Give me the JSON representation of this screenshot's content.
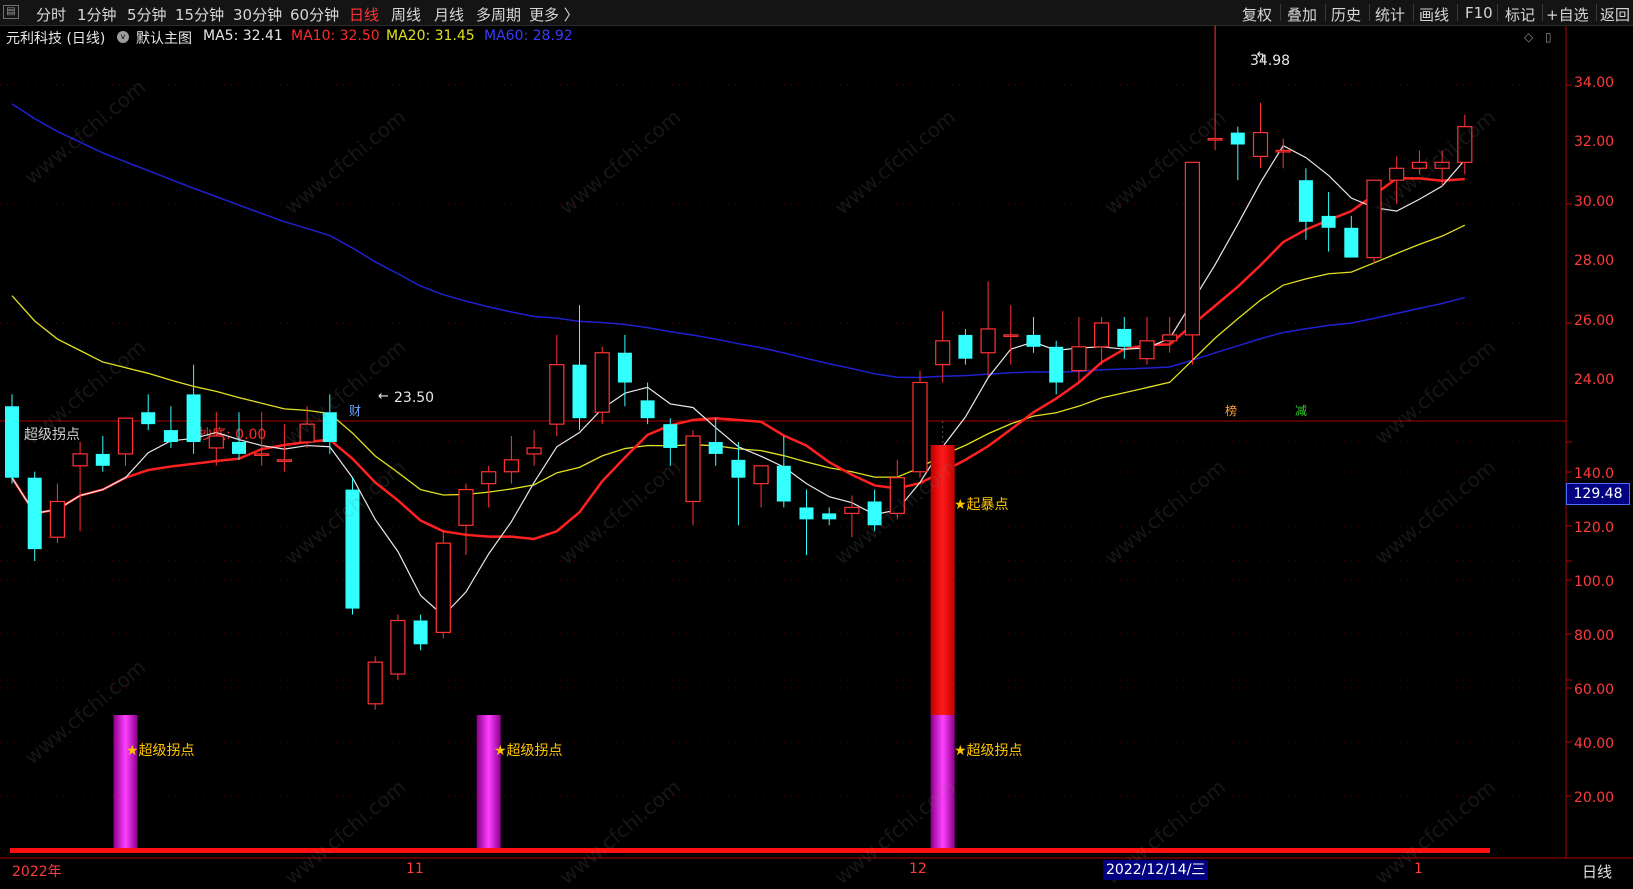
{
  "toolbar": {
    "menu_icon": "menu-icon",
    "periods": [
      "分时",
      "1分钟",
      "5分钟",
      "15分钟",
      "30分钟",
      "60分钟",
      "日线",
      "周线",
      "月线",
      "多周期",
      "更多 〉"
    ],
    "active_period": "日线",
    "tools": [
      "复权",
      "叠加",
      "历史",
      "统计",
      "画线",
      "F10",
      "标记",
      "+自选",
      "返回"
    ]
  },
  "main_chart": {
    "stock": "元利科技 (日线)",
    "template": "默认主图",
    "ma5": "MA5: 32.41",
    "ma10": "MA10: 32.50",
    "ma20": "MA20: 31.45",
    "ma60": "MA60: 28.92",
    "high_label": "34.98",
    "low_label": "23.50",
    "y_ticks": [
      "34.00",
      "32.00",
      "30.00",
      "28.00",
      "26.00",
      "24.00"
    ],
    "events": [
      {
        "text": "财",
        "color": "#6ea8ff"
      },
      {
        "text": "榜",
        "color": "#ffa030"
      },
      {
        "text": "减",
        "color": "#30d030"
      }
    ]
  },
  "indicator": {
    "name": "超级拐点",
    "value_text": "抄底: 0.00",
    "y_ticks": [
      "140.0",
      "120.0",
      "100.0",
      "80.00",
      "60.00",
      "40.00",
      "20.00"
    ],
    "cursor_value": "129.48",
    "signals": [
      {
        "label": "★超级拐点",
        "value": 50
      },
      {
        "label": "★超级拐点",
        "value": 50
      },
      {
        "label": "★超级拐点",
        "value": 50
      }
    ],
    "spike": {
      "label": "★起暴点",
      "value": 150
    }
  },
  "x_axis": {
    "labels": [
      "2022年",
      "11",
      "12",
      "1"
    ],
    "cursor_date": "2022/12/14/三",
    "period_button": "日线"
  },
  "watermark": "www.cfchi.com",
  "colors": {
    "up": "#ff3333",
    "down": "#33ffff",
    "ma5": "#e8e8e8",
    "ma10": "#ff2020",
    "ma20": "#e0e020",
    "ma60": "#2020d0"
  },
  "chart_data": {
    "type": "candlestick",
    "ma_values": {
      "MA5": 32.41,
      "MA10": 32.5,
      "MA20": 31.45,
      "MA60": 28.92
    },
    "ylim": [
      23,
      35
    ],
    "indicator_ylim": [
      0,
      150
    ],
    "candles": [
      [
        28.6,
        28.8,
        27.3,
        27.4
      ],
      [
        27.4,
        27.5,
        26.0,
        26.2
      ],
      [
        26.4,
        27.3,
        26.3,
        27.0
      ],
      [
        27.6,
        28.0,
        26.5,
        27.8
      ],
      [
        27.8,
        28.1,
        27.5,
        27.6
      ],
      [
        27.8,
        28.4,
        27.6,
        28.4
      ],
      [
        28.5,
        28.8,
        28.2,
        28.3
      ],
      [
        28.2,
        28.6,
        27.9,
        28.0
      ],
      [
        28.8,
        29.3,
        27.8,
        28.0
      ],
      [
        27.9,
        28.5,
        27.6,
        28.1
      ],
      [
        28.0,
        28.5,
        27.7,
        27.8
      ],
      [
        27.8,
        28.5,
        27.6,
        27.8
      ],
      [
        27.7,
        28.3,
        27.5,
        27.7
      ],
      [
        28.0,
        28.6,
        27.9,
        28.3
      ],
      [
        28.5,
        28.8,
        27.8,
        28.0
      ],
      [
        27.2,
        27.4,
        25.1,
        25.2
      ],
      [
        23.6,
        24.4,
        23.5,
        24.3
      ],
      [
        24.1,
        25.1,
        24.0,
        25.0
      ],
      [
        25.0,
        25.1,
        24.5,
        24.6
      ],
      [
        24.8,
        26.5,
        24.7,
        26.3
      ],
      [
        26.6,
        27.3,
        26.1,
        27.2
      ],
      [
        27.3,
        27.6,
        26.9,
        27.5
      ],
      [
        27.5,
        28.1,
        27.3,
        27.7
      ],
      [
        27.8,
        28.2,
        27.6,
        27.9
      ],
      [
        28.3,
        29.8,
        28.1,
        29.3
      ],
      [
        29.3,
        30.3,
        28.2,
        28.4
      ],
      [
        28.5,
        29.6,
        28.3,
        29.5
      ],
      [
        29.5,
        29.8,
        28.6,
        29.0
      ],
      [
        28.7,
        29.0,
        28.3,
        28.4
      ],
      [
        28.3,
        28.4,
        27.6,
        27.9
      ],
      [
        27.0,
        28.2,
        26.6,
        28.1
      ],
      [
        28.0,
        28.4,
        27.6,
        27.8
      ],
      [
        27.7,
        28.0,
        26.6,
        27.4
      ],
      [
        27.3,
        27.6,
        26.9,
        27.6
      ],
      [
        27.6,
        28.1,
        26.9,
        27.0
      ],
      [
        26.9,
        27.2,
        26.1,
        26.7
      ],
      [
        26.8,
        26.9,
        26.6,
        26.7
      ],
      [
        26.8,
        27.1,
        26.4,
        26.9
      ],
      [
        27.0,
        27.2,
        26.5,
        26.6
      ],
      [
        26.8,
        27.7,
        26.7,
        27.4
      ],
      [
        27.5,
        29.2,
        27.4,
        29.0
      ],
      [
        29.3,
        30.2,
        29.0,
        29.7
      ],
      [
        29.8,
        29.9,
        29.3,
        29.4
      ],
      [
        29.5,
        30.7,
        29.1,
        29.9
      ],
      [
        29.8,
        30.3,
        29.3,
        29.8
      ],
      [
        29.8,
        30.1,
        29.5,
        29.6
      ],
      [
        29.6,
        29.7,
        28.8,
        29.0
      ],
      [
        29.2,
        30.1,
        29.0,
        29.6
      ],
      [
        29.6,
        30.1,
        29.3,
        30.0
      ],
      [
        29.9,
        30.1,
        29.4,
        29.6
      ],
      [
        29.4,
        30.1,
        29.3,
        29.7
      ],
      [
        29.7,
        30.1,
        29.5,
        29.8
      ],
      [
        29.8,
        32.7,
        29.3,
        32.7
      ],
      [
        33.1,
        35.0,
        32.9,
        33.1
      ],
      [
        33.2,
        33.3,
        32.4,
        33.0
      ],
      [
        32.8,
        33.7,
        32.6,
        33.2
      ],
      [
        32.9,
        33.1,
        32.6,
        32.9
      ],
      [
        32.4,
        32.6,
        31.4,
        31.7
      ],
      [
        31.8,
        32.2,
        31.2,
        31.6
      ],
      [
        31.6,
        31.8,
        31.1,
        31.1
      ],
      [
        31.1,
        32.4,
        31.0,
        32.4
      ],
      [
        32.4,
        32.8,
        32.0,
        32.6
      ],
      [
        32.6,
        32.9,
        32.5,
        32.7
      ],
      [
        32.6,
        32.9,
        32.3,
        32.7
      ],
      [
        32.7,
        33.5,
        32.5,
        33.3
      ]
    ],
    "signal_bars": [
      [
        5,
        50
      ],
      [
        21,
        50
      ],
      [
        41,
        150
      ]
    ]
  }
}
